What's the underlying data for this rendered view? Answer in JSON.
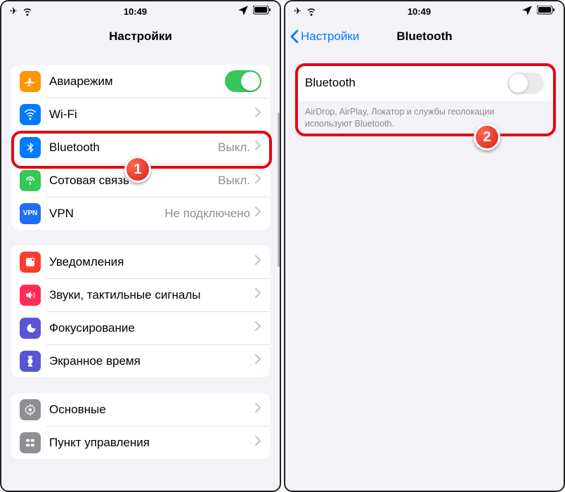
{
  "status": {
    "time": "10:49"
  },
  "left": {
    "title": "Настройки",
    "group1": [
      {
        "icon": "airplane",
        "label": "Авиарежим",
        "toggle": true
      },
      {
        "icon": "wifi",
        "label": "Wi-Fi",
        "value": "",
        "chev": true
      },
      {
        "icon": "bluetooth",
        "label": "Bluetooth",
        "value": "Выкл.",
        "chev": true
      },
      {
        "icon": "cellular",
        "label": "Сотовая связь",
        "value": "Выкл.",
        "chev": true
      },
      {
        "icon": "vpn",
        "label": "VPN",
        "value": "Не подключено",
        "chev": true
      }
    ],
    "group2": [
      {
        "icon": "notifications",
        "label": "Уведомления"
      },
      {
        "icon": "sounds",
        "label": "Звуки, тактильные сигналы"
      },
      {
        "icon": "focus",
        "label": "Фокусирование"
      },
      {
        "icon": "screentime",
        "label": "Экранное время"
      }
    ],
    "group3": [
      {
        "icon": "general",
        "label": "Основные"
      },
      {
        "icon": "control",
        "label": "Пункт управления"
      }
    ]
  },
  "right": {
    "back": "Настройки",
    "title": "Bluetooth",
    "row_label": "Bluetooth",
    "note": "AirDrop, AirPlay, Локатор и службы геолокации используют Bluetooth."
  },
  "callouts": {
    "one": "1",
    "two": "2"
  }
}
